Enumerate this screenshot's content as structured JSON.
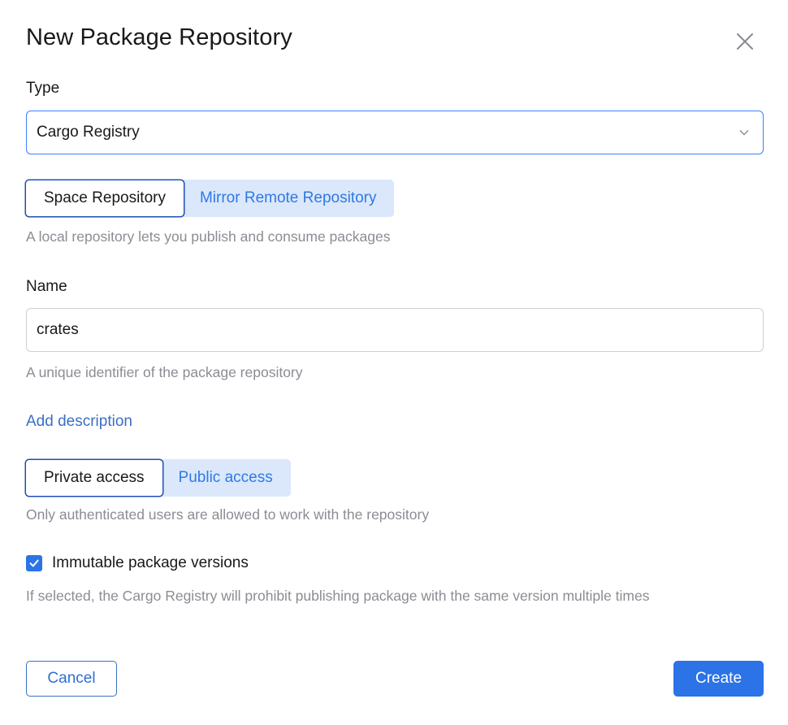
{
  "dialog": {
    "title": "New Package Repository",
    "close_icon": "close-icon"
  },
  "type_field": {
    "label": "Type",
    "selected": "Cargo Registry",
    "chevron_icon": "chevron-down-icon"
  },
  "repo_kind": {
    "options": [
      "Space Repository",
      "Mirror Remote Repository"
    ],
    "selected": "Space Repository",
    "hint": "A local repository lets you publish and consume packages"
  },
  "name_field": {
    "label": "Name",
    "value": "crates",
    "hint": "A unique identifier of the package repository"
  },
  "add_description_link": "Add description",
  "access": {
    "options": [
      "Private access",
      "Public access"
    ],
    "selected": "Private access",
    "hint": "Only authenticated users are allowed to work with the repository"
  },
  "immutable": {
    "checked": true,
    "label": "Immutable package versions",
    "hint": "If selected, the Cargo Registry will prohibit publishing package with the same version multiple times",
    "check_icon": "checkmark-icon"
  },
  "footer": {
    "cancel_label": "Cancel",
    "create_label": "Create"
  },
  "colors": {
    "accent": "#2b73e6",
    "segment_inactive_bg": "#dbe8fb",
    "hint_text": "#8c8c94"
  }
}
